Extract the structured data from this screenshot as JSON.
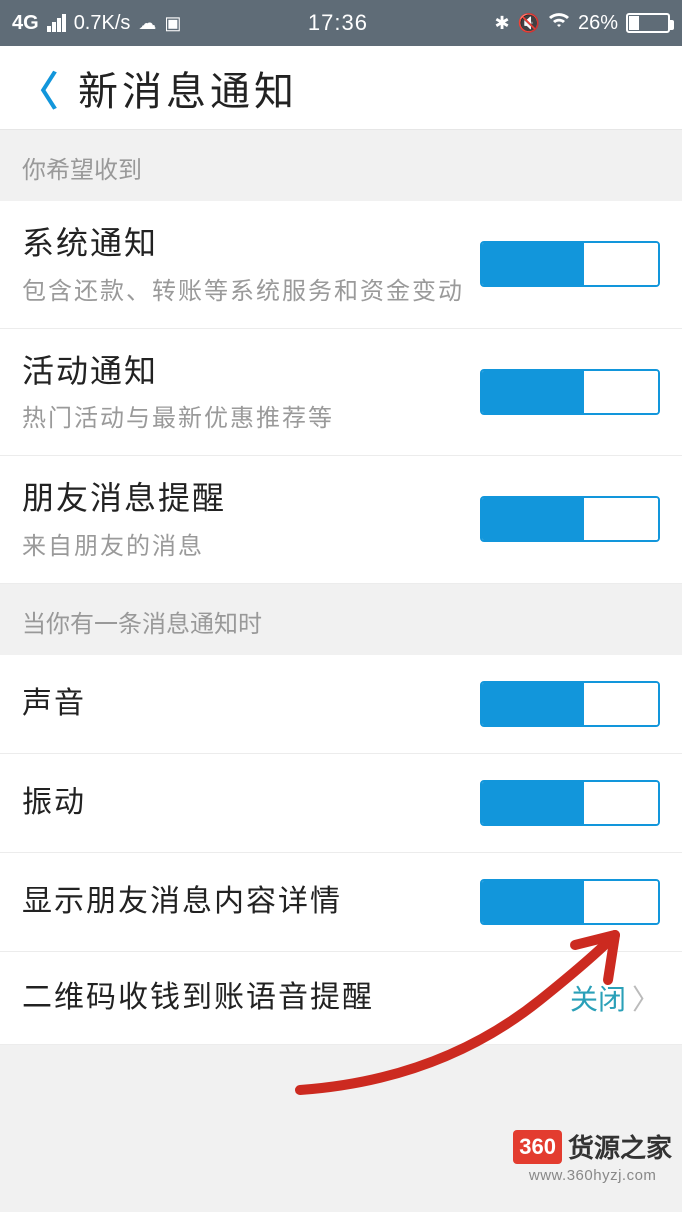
{
  "status_bar": {
    "network": "4G",
    "speed": "0.7K/s",
    "time": "17:36",
    "battery_pct": "26%",
    "battery_fill_pct": 26
  },
  "header": {
    "title": "新消息通知"
  },
  "sections": {
    "receive_header": "你希望收到",
    "when_msg_header": "当你有一条消息通知时"
  },
  "rows": {
    "system_notice": {
      "title": "系统通知",
      "sub": "包含还款、转账等系统服务和资金变动"
    },
    "activity_notice": {
      "title": "活动通知",
      "sub": "热门活动与最新优惠推荐等"
    },
    "friend_alert": {
      "title": "朋友消息提醒",
      "sub": "来自朋友的消息"
    },
    "sound": {
      "title": "声音"
    },
    "vibrate": {
      "title": "振动"
    },
    "show_detail": {
      "title": "显示朋友消息内容详情"
    },
    "qr_voice": {
      "title": "二维码收钱到账语音提醒",
      "value": "关闭"
    }
  },
  "watermark": {
    "badge": "360",
    "text": "货源之家",
    "url": "www.360hyzj.com"
  }
}
